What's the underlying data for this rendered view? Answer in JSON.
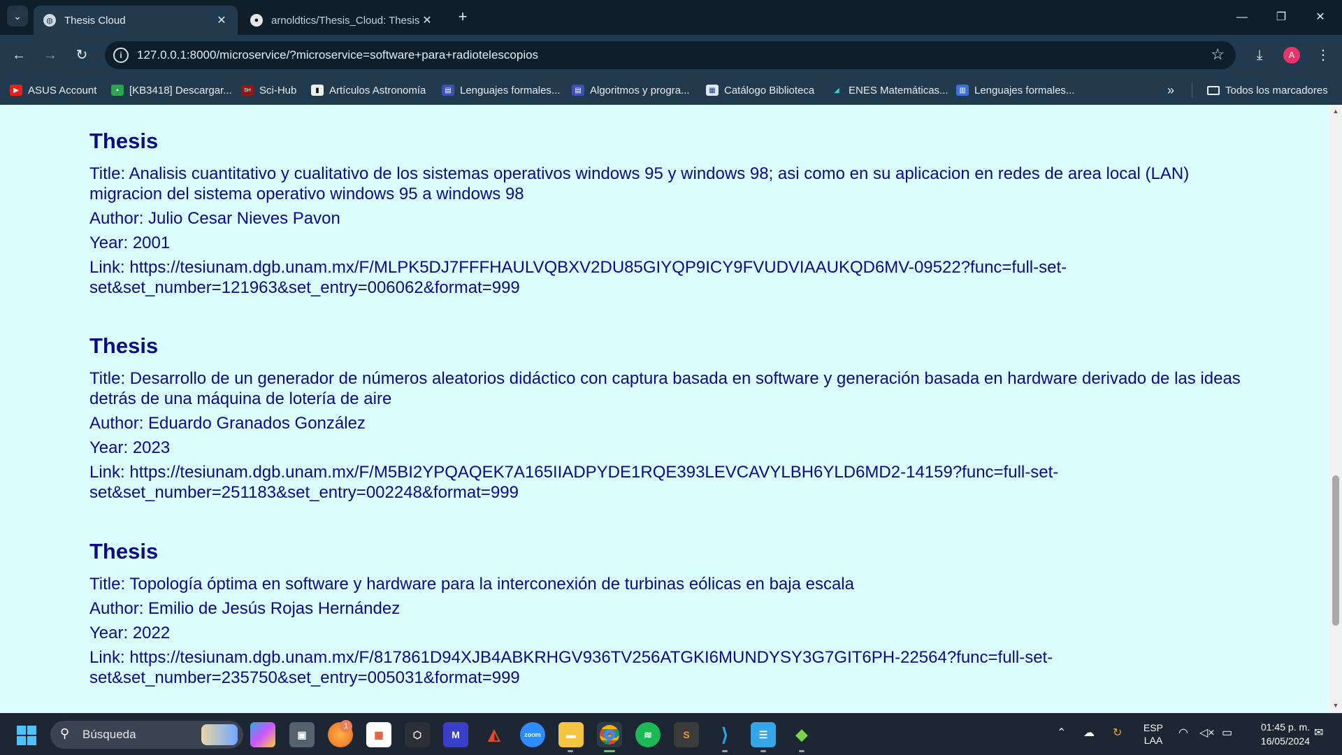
{
  "browser": {
    "tabs": [
      {
        "title": "Thesis Cloud",
        "active": true
      },
      {
        "title": "arnoldtics/Thesis_Cloud: Thesis",
        "active": false
      }
    ],
    "url": "127.0.0.1:8000/microservice/?microservice=software+para+radiotelescopios",
    "bookmarks": [
      "ASUS Account",
      "[KB3418] Descargar...",
      "Sci-Hub",
      "Artículos Astronomía",
      "Lenguajes formales...",
      "Algoritmos y progra...",
      "Catálogo Biblioteca",
      "ENES Matemáticas...",
      "Lenguajes formales..."
    ],
    "all_bookmarks": "Todos los marcadores",
    "profile_initial": "A"
  },
  "theses": [
    {
      "heading": "Thesis",
      "title": "Title: Analisis cuantitativo y cualitativo de los sistemas operativos windows 95 y windows 98; asi como en su aplicacion en redes de area local (LAN) migracion del sistema operativo windows 95 a windows 98",
      "author": "Author: Julio Cesar Nieves Pavon",
      "year": "Year: 2001",
      "link": "Link: https://tesiunam.dgb.unam.mx/F/MLPK5DJ7FFFHAULVQBXV2DU85GIYQP9ICY9FVUDVIAAUKQD6MV-09522?func=full-set-set&set_number=121963&set_entry=006062&format=999"
    },
    {
      "heading": "Thesis",
      "title": "Title: Desarrollo de un generador de números aleatorios didáctico con captura basada en software y generación basada en hardware derivado de las ideas detrás de una máquina de lotería de aire",
      "author": "Author: Eduardo Granados González",
      "year": "Year: 2023",
      "link": "Link: https://tesiunam.dgb.unam.mx/F/M5BI2YPQAQEK7A165IIADPYDE1RQE393LEVCAVYLBH6YLD6MD2-14159?func=full-set-set&set_number=251183&set_entry=002248&format=999"
    },
    {
      "heading": "Thesis",
      "title": "Title: Topología óptima en software y hardware para la interconexión de turbinas eólicas en baja escala",
      "author": "Author: Emilio de Jesús Rojas Hernández",
      "year": "Year: 2022",
      "link": "Link: https://tesiunam.dgb.unam.mx/F/817861D94XJB4ABKRHGV936TV256ATGKI6MUNDYSY3G7GIT6PH-22564?func=full-set-set&set_number=235750&set_entry=005031&format=999"
    }
  ],
  "taskbar": {
    "search_placeholder": "Búsqueda",
    "notification_badge": "1",
    "lang_top": "ESP",
    "lang_bottom": "LAA",
    "time": "01:45 p. m.",
    "date": "16/05/2024"
  },
  "colors": {
    "page_background": "#dbfdfd",
    "text": "#0a0a8a",
    "chrome_frame": "#0f1e2b",
    "chrome_toolbar": "#223a4d",
    "taskbar": "#1d2733"
  }
}
